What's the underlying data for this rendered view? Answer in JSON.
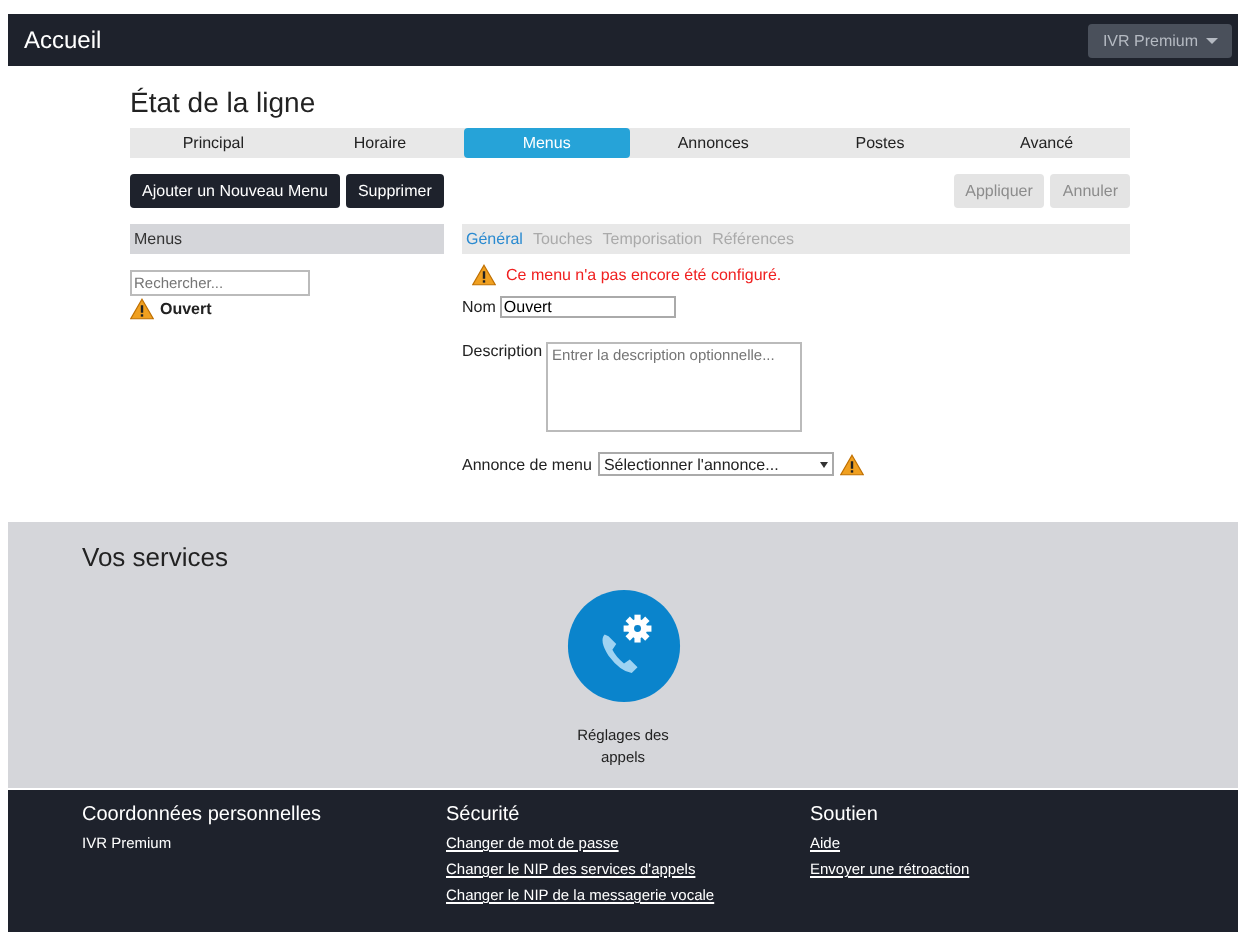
{
  "header": {
    "title": "Accueil",
    "account_button": "IVR Premium"
  },
  "page_title": "État de la ligne",
  "tabs": [
    {
      "label": "Principal",
      "selected": false
    },
    {
      "label": "Horaire",
      "selected": false
    },
    {
      "label": "Menus",
      "selected": true
    },
    {
      "label": "Annonces",
      "selected": false
    },
    {
      "label": "Postes",
      "selected": false
    },
    {
      "label": "Avancé",
      "selected": false
    }
  ],
  "toolbar": {
    "left_buttons": [
      {
        "label": "Ajouter un Nouveau Menu",
        "disabled": false
      },
      {
        "label": "Supprimer",
        "disabled": false
      }
    ],
    "right_buttons": [
      {
        "label": "Appliquer",
        "disabled": true
      },
      {
        "label": "Annuler",
        "disabled": true
      }
    ]
  },
  "menus_panel": {
    "title": "Menus",
    "search": {
      "placeholder": "Rechercher..."
    },
    "items": [
      {
        "label": "Ouvert",
        "warning": true
      }
    ]
  },
  "editor": {
    "subtabs": [
      {
        "label": "Général",
        "selected": true
      },
      {
        "label": "Touches",
        "selected": false
      },
      {
        "label": "Temporisation",
        "selected": false
      },
      {
        "label": "Références",
        "selected": false
      }
    ],
    "alert": "Ce menu n'a pas encore été configuré.",
    "name_label": "Nom",
    "name_value": "Ouvert",
    "description_label": "Description",
    "description_placeholder": "Entrer la description optionnelle...",
    "announcement_label": "Annonce de menu",
    "announcement_value": "Sélectionner l'annonce...",
    "announcement_warning": true
  },
  "services": {
    "title": "Vos services",
    "items": [
      {
        "label": "Réglages des appels"
      }
    ]
  },
  "footer": {
    "columns": [
      {
        "title": "Coordonnées personnelles",
        "items": [
          {
            "text": "IVR Premium",
            "link": false
          }
        ]
      },
      {
        "title": "Sécurité",
        "items": [
          {
            "text": "Changer de mot de passe",
            "link": true
          },
          {
            "text": "Changer le NIP des services d'appels",
            "link": true
          },
          {
            "text": "Changer le NIP de la messagerie vocale",
            "link": true
          }
        ]
      },
      {
        "title": "Soutien",
        "items": [
          {
            "text": "Aide",
            "link": true
          },
          {
            "text": "Envoyer une rétroaction",
            "link": true
          }
        ]
      }
    ]
  }
}
